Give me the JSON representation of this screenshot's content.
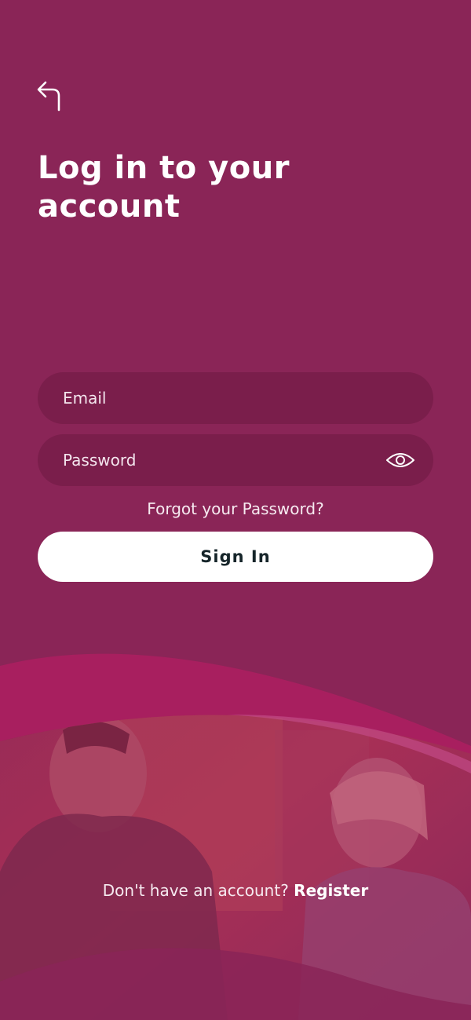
{
  "header": {
    "back_icon": "back-arrow-icon",
    "title": "Log in to your account"
  },
  "form": {
    "email_placeholder": "Email",
    "password_placeholder": "Password",
    "show_password_icon": "eye-icon",
    "forgot_password": "Forgot your Password?",
    "sign_in_label": "Sign In"
  },
  "footer": {
    "prompt": "Don't have an account?",
    "register_label": "Register"
  },
  "colors": {
    "background": "#8a2557",
    "input_fill": "#7a1e4b",
    "button_fill": "#ffffff",
    "button_text": "#16252a",
    "wave_accent": "#a81f5f"
  }
}
